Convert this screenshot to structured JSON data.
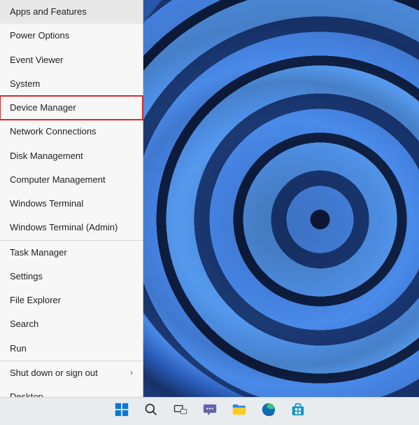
{
  "context_menu": {
    "groups": [
      [
        {
          "label": "Apps and Features",
          "submenu": false,
          "highlighted": false
        },
        {
          "label": "Power Options",
          "submenu": false,
          "highlighted": false
        },
        {
          "label": "Event Viewer",
          "submenu": false,
          "highlighted": false
        },
        {
          "label": "System",
          "submenu": false,
          "highlighted": false
        },
        {
          "label": "Device Manager",
          "submenu": false,
          "highlighted": true
        },
        {
          "label": "Network Connections",
          "submenu": false,
          "highlighted": false
        },
        {
          "label": "Disk Management",
          "submenu": false,
          "highlighted": false
        },
        {
          "label": "Computer Management",
          "submenu": false,
          "highlighted": false
        },
        {
          "label": "Windows Terminal",
          "submenu": false,
          "highlighted": false
        },
        {
          "label": "Windows Terminal (Admin)",
          "submenu": false,
          "highlighted": false
        }
      ],
      [
        {
          "label": "Task Manager",
          "submenu": false,
          "highlighted": false
        },
        {
          "label": "Settings",
          "submenu": false,
          "highlighted": false
        },
        {
          "label": "File Explorer",
          "submenu": false,
          "highlighted": false
        },
        {
          "label": "Search",
          "submenu": false,
          "highlighted": false
        },
        {
          "label": "Run",
          "submenu": false,
          "highlighted": false
        }
      ],
      [
        {
          "label": "Shut down or sign out",
          "submenu": true,
          "highlighted": false
        },
        {
          "label": "Desktop",
          "submenu": false,
          "highlighted": false
        }
      ]
    ]
  },
  "taskbar": {
    "items": [
      {
        "name": "start-button",
        "icon": "start-icon"
      },
      {
        "name": "search-button",
        "icon": "search-icon"
      },
      {
        "name": "task-view-button",
        "icon": "taskview-icon"
      },
      {
        "name": "chat-button",
        "icon": "chat-icon"
      },
      {
        "name": "file-explorer-button",
        "icon": "explorer-icon"
      },
      {
        "name": "edge-button",
        "icon": "edge-icon"
      },
      {
        "name": "store-button",
        "icon": "store-icon"
      }
    ]
  },
  "colors": {
    "highlight_border": "#d82a2a",
    "menu_bg": "#f7f7f7",
    "taskbar_bg": "#e9ecef"
  }
}
